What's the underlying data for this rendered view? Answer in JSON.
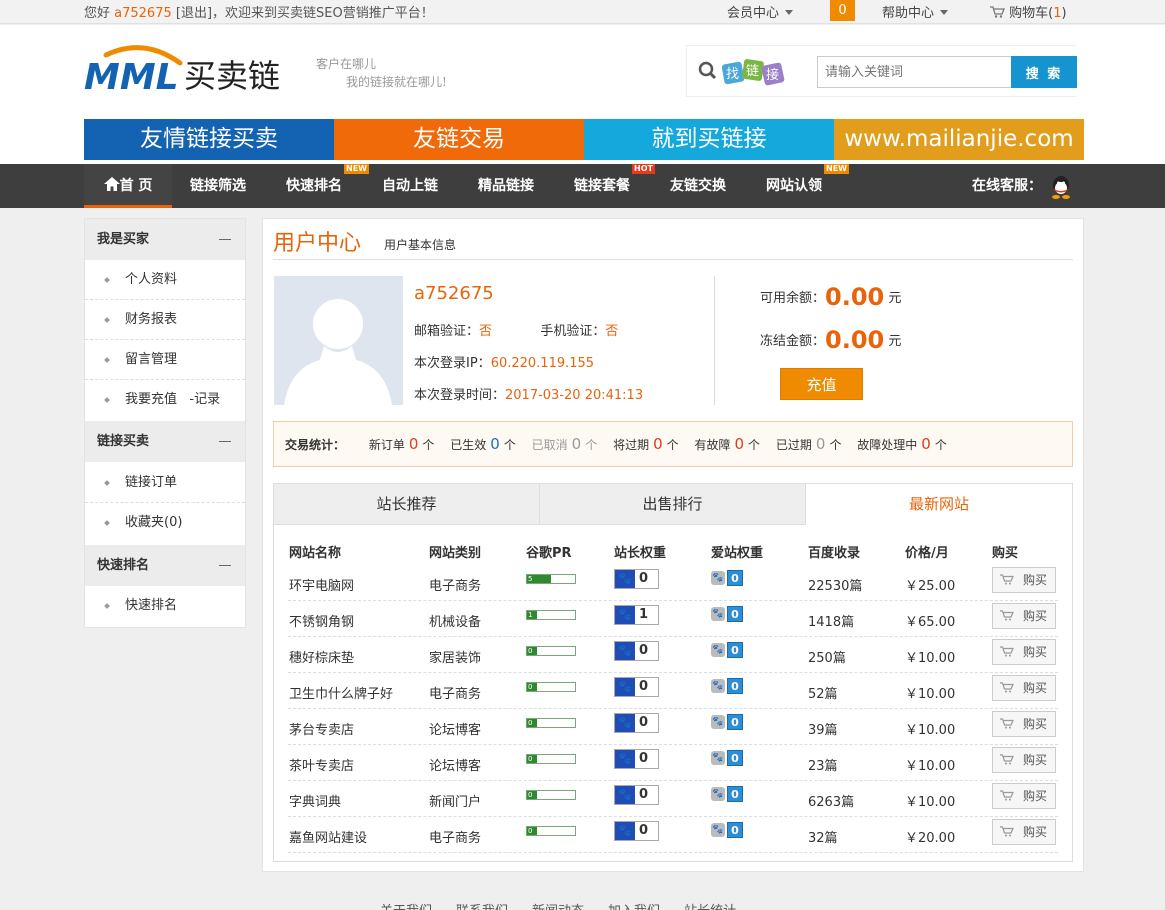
{
  "topbar": {
    "greeting": "您好",
    "username": "a752675",
    "logout": "[退出]",
    "welcome": "，欢迎来到买卖链SEO营销推广平台！",
    "member_center": "会员中心",
    "msg_count": "0",
    "help_center": "帮助中心",
    "cart_label": "购物车(",
    "cart_count": "1",
    "cart_close": ")"
  },
  "header": {
    "logo_mark": "MML",
    "logo_text": "买卖链",
    "slogan_line1": "客户在哪儿",
    "slogan_line2": "我的链接就在哪儿!",
    "search_badge": [
      "找",
      "链",
      "接"
    ],
    "search_placeholder": "请输入关键词",
    "search_button": "搜 索"
  },
  "banner": [
    {
      "text": "友情链接买卖",
      "color": "#1463b3"
    },
    {
      "text": "友链交易",
      "color": "#f06a0a"
    },
    {
      "text": "就到买链接",
      "color": "#15a8dc"
    },
    {
      "text": "www.mailianjie.com",
      "color": "#e39d1d"
    }
  ],
  "nav": {
    "items": [
      {
        "label": "首 页"
      },
      {
        "label": "链接筛选"
      },
      {
        "label": "快速排名",
        "badge": "NEW"
      },
      {
        "label": "自动上链"
      },
      {
        "label": "精品链接"
      },
      {
        "label": "链接套餐",
        "badge": "HOT"
      },
      {
        "label": "友链交换"
      },
      {
        "label": "网站认领",
        "badge": "NEW"
      }
    ],
    "service": "在线客服："
  },
  "sidebar": {
    "sections": [
      {
        "title": "我是买家",
        "items": [
          "个人资料",
          "财务报表",
          "留言管理",
          "我要充值   -记录"
        ]
      },
      {
        "title": "链接买卖",
        "items": [
          "链接订单",
          "收藏夹(0)"
        ]
      },
      {
        "title": "快速排名",
        "items": [
          "快速排名"
        ]
      }
    ]
  },
  "user": {
    "title": "用户中心",
    "subtitle": "用户基本信息",
    "name": "a752675",
    "email_label": "邮箱验证：",
    "email_value": "否",
    "phone_label": "手机验证：",
    "phone_value": "否",
    "ip_label": "本次登录IP：",
    "ip_value": "60.220.119.155",
    "time_label": "本次登录时间：",
    "time_value": "2017-03-20 20:41:13",
    "available_label": "可用余额：",
    "available_value": "0.00",
    "frozen_label": "冻结金额：",
    "frozen_value": "0.00",
    "currency": "元",
    "charge_button": "充值"
  },
  "stats": {
    "label": "交易统计：",
    "unit": "个",
    "items": [
      {
        "label": "新订单",
        "value": "0"
      },
      {
        "label": "已生效",
        "value": "0"
      },
      {
        "label": "已取消",
        "value": "0"
      },
      {
        "label": "将过期",
        "value": "0"
      },
      {
        "label": "有故障",
        "value": "0"
      },
      {
        "label": "已过期",
        "value": "0"
      },
      {
        "label": "故障处理中",
        "value": "0"
      }
    ]
  },
  "tabs": [
    "站长推荐",
    "出售排行",
    "最新网站"
  ],
  "table": {
    "headers": [
      "网站名称",
      "网站类别",
      "谷歌PR",
      "站长权重",
      "爱站权重",
      "百度收录",
      "价格/月",
      "购买"
    ],
    "buy_label": "购买",
    "rows": [
      {
        "name": "环宇电脑网",
        "category": "电子商务",
        "pr": 5,
        "zz": "0",
        "az": "0",
        "baidu": "22530篇",
        "price": "￥25.00"
      },
      {
        "name": "不锈钢角钢",
        "category": "机械设备",
        "pr": 1,
        "zz": "1",
        "az": "0",
        "baidu": "1418篇",
        "price": "￥65.00"
      },
      {
        "name": "穗好棕床垫",
        "category": "家居装饰",
        "pr": 0,
        "zz": "0",
        "az": "0",
        "baidu": "250篇",
        "price": "￥10.00"
      },
      {
        "name": "卫生巾什么牌子好",
        "category": "电子商务",
        "pr": 0,
        "zz": "0",
        "az": "0",
        "baidu": "52篇",
        "price": "￥10.00"
      },
      {
        "name": "茅台专卖店",
        "category": "论坛博客",
        "pr": 0,
        "zz": "0",
        "az": "0",
        "baidu": "39篇",
        "price": "￥10.00"
      },
      {
        "name": "茶叶专卖店",
        "category": "论坛博客",
        "pr": 0,
        "zz": "0",
        "az": "0",
        "baidu": "23篇",
        "price": "￥10.00"
      },
      {
        "name": "字典词典",
        "category": "新闻门户",
        "pr": 0,
        "zz": "0",
        "az": "0",
        "baidu": "6263篇",
        "price": "￥10.00"
      },
      {
        "name": "嘉鱼网站建设",
        "category": "电子商务",
        "pr": 0,
        "zz": "0",
        "az": "0",
        "baidu": "32篇",
        "price": "￥20.00"
      }
    ]
  },
  "footer": {
    "links": [
      "关于我们",
      "联系我们",
      "新闻动态",
      "加入我们",
      "站长统计"
    ]
  }
}
